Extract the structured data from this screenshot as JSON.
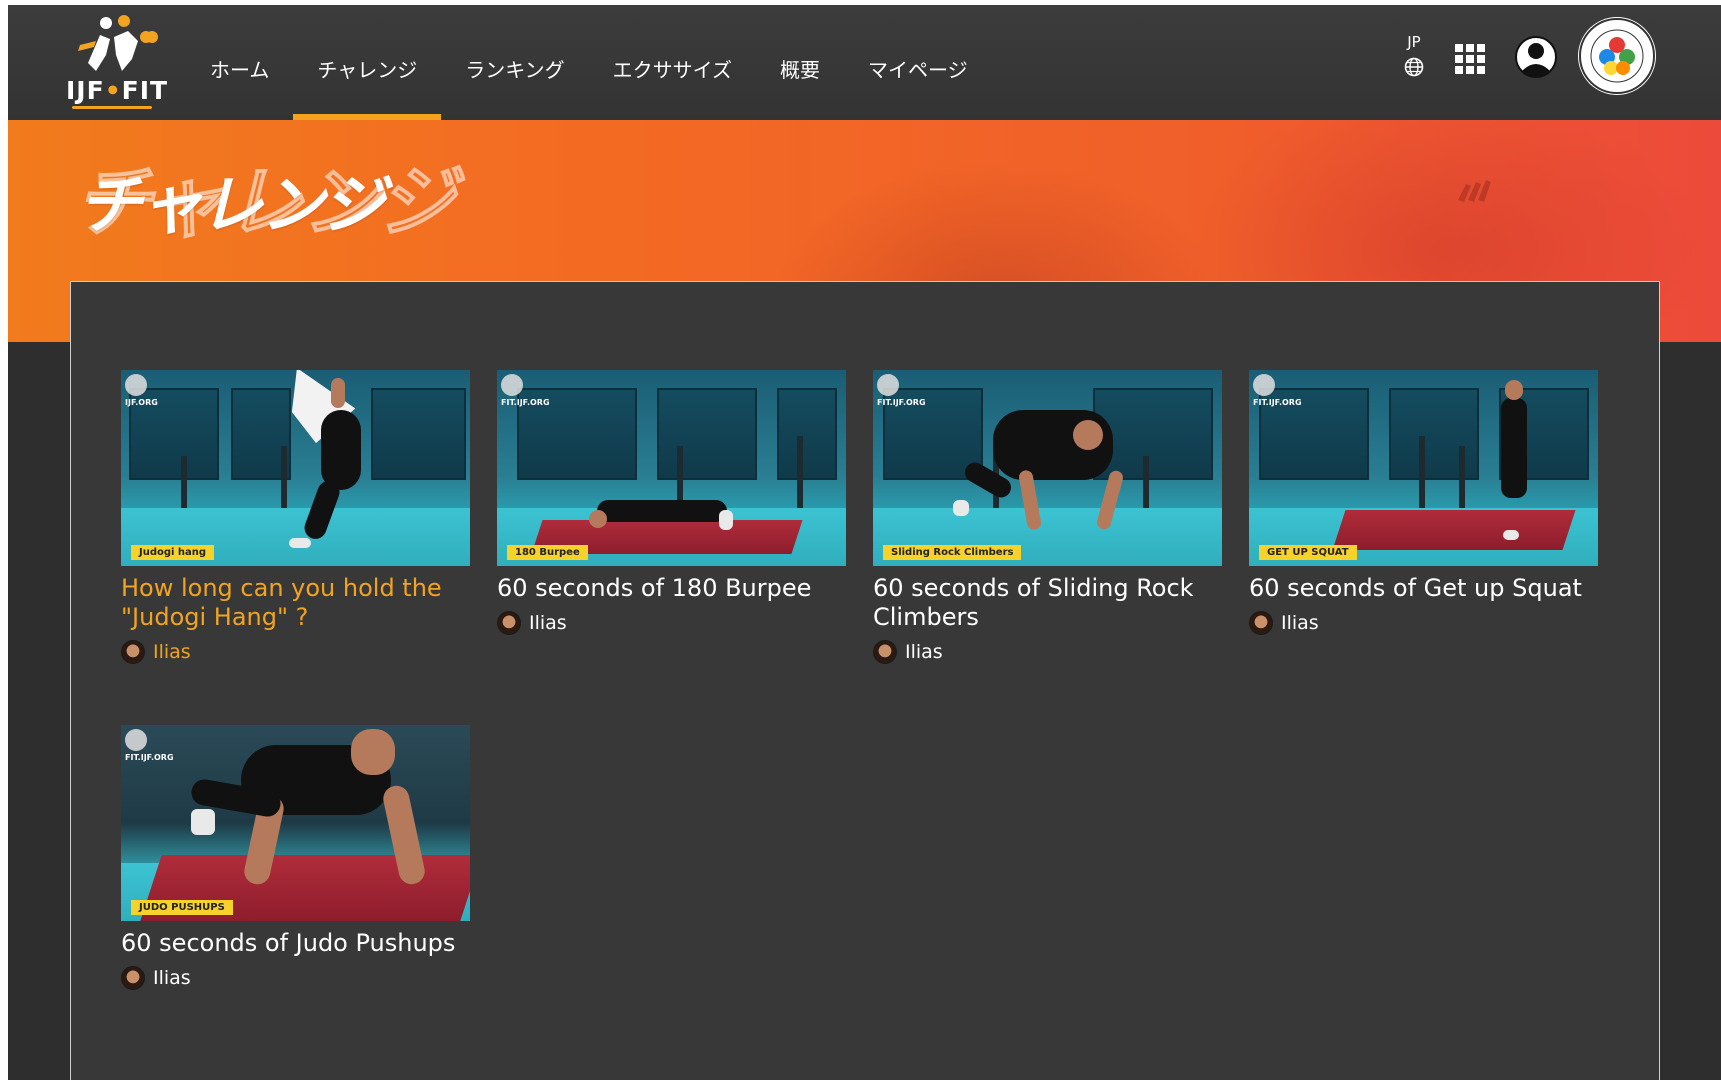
{
  "brand": {
    "logo_text_left": "IJF",
    "logo_text_right": "FIT"
  },
  "nav": {
    "items": [
      {
        "label": "ホーム"
      },
      {
        "label": "チャレンジ",
        "active": true
      },
      {
        "label": "ランキング"
      },
      {
        "label": "エクササイズ"
      },
      {
        "label": "概要"
      },
      {
        "label": "マイページ"
      }
    ]
  },
  "header": {
    "language": "JP"
  },
  "hero": {
    "title": "チャレンジ"
  },
  "colors": {
    "accent": "#f2a421",
    "hero_start": "#f27b1d",
    "hero_end": "#ec4a3a",
    "panel": "#383838",
    "tag_yellow": "#f6d22a"
  },
  "cards": [
    {
      "title": "How long can you hold the \"Judogi Hang\" ?",
      "author": "Ilias",
      "tag": "Judogi hang",
      "watermark": "IJF.ORG"
    },
    {
      "title": "60 seconds of 180 Burpee",
      "author": "Ilias",
      "tag": "180 Burpee",
      "watermark": "FIT.IJF.ORG"
    },
    {
      "title": "60 seconds of Sliding Rock Climbers",
      "author": "Ilias",
      "tag": "Sliding Rock Climbers",
      "watermark": "FIT.IJF.ORG"
    },
    {
      "title": "60 seconds of Get up Squat",
      "author": "Ilias",
      "tag": "GET UP SQUAT",
      "watermark": "FIT.IJF.ORG"
    },
    {
      "title": "60 seconds of Judo Pushups",
      "author": "Ilias",
      "tag": "JUDO PUSHUPS",
      "watermark": "FIT.IJF.ORG"
    }
  ]
}
